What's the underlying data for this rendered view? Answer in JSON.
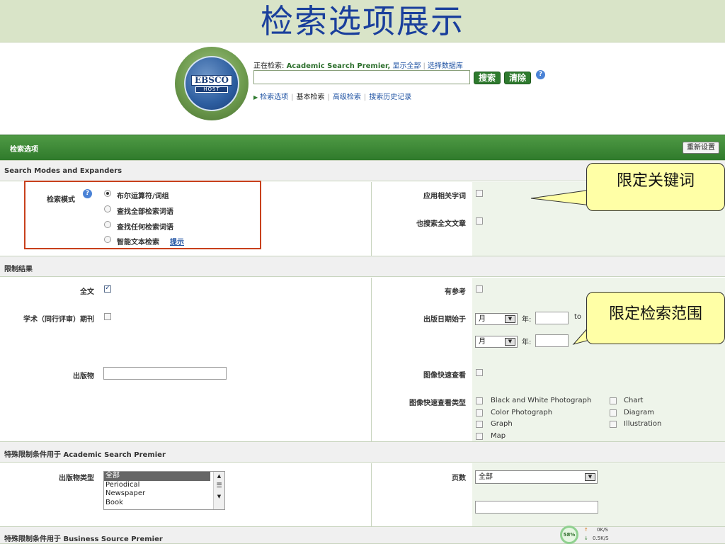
{
  "slide": {
    "title": "检索选项展示"
  },
  "logo": {
    "word": "EBSCO",
    "sub": "HOST"
  },
  "search": {
    "prefix": "正在检索:",
    "database": "Academic Search Premier,",
    "show_all": "显示全部",
    "choose_db": "选择数据库",
    "input_value": "",
    "search_button": "搜索",
    "clear_button": "清除"
  },
  "nav": {
    "options": "检索选项",
    "basic": "基本检索",
    "advanced": "高级检索",
    "history": "搜索历史记录"
  },
  "panel": {
    "header": "检索选项",
    "reset": "重新设置"
  },
  "sections": {
    "modes": "Search Modes and Expanders",
    "limit": "限制结果",
    "special1": "特殊限制条件用于 Academic Search Premier",
    "special2": "特殊限制条件用于 Business Source Premier"
  },
  "modes": {
    "label": "检索模式",
    "options": [
      {
        "label": "布尔运算符/词组",
        "selected": true
      },
      {
        "label": "查找全部检索词语",
        "selected": false
      },
      {
        "label": "查找任何检索词语",
        "selected": false
      },
      {
        "label": "智能文本检索",
        "selected": false
      }
    ],
    "tip": "提示"
  },
  "expanders": {
    "related": "应用相关字词",
    "fulltext_search": "也搜索全文文章"
  },
  "limits": {
    "fulltext": {
      "label": "全文",
      "checked": true
    },
    "has_refs": "有参考",
    "peer_review": "学术（同行评审）期刊",
    "pub_date": "出版日期始于",
    "month": "月",
    "year": "年:",
    "to": "to",
    "publication": "出版物",
    "image_quick": "图像快速查看",
    "image_types_label": "图像快速查看类型",
    "image_types": [
      "Black and White Photograph",
      "Color Photograph",
      "Graph",
      "Map",
      "Chart",
      "Diagram",
      "Illustration"
    ]
  },
  "special": {
    "pubtype_label": "出版物类型",
    "pubtypes": [
      "全部",
      "Periodical",
      "Newspaper",
      "Book"
    ],
    "pages_label": "页数",
    "pages_value": "全部"
  },
  "callouts": {
    "keywords": "限定关键词",
    "scope": "限定检索范围"
  },
  "net": {
    "percent": "58%",
    "up": "0K/S",
    "down": "0.5K/S"
  },
  "colors": {
    "green": "#2e7a2e",
    "title_blue": "#1a3f9c",
    "highlight_red": "#c8401c",
    "callout_yellow": "#ffffa6"
  }
}
